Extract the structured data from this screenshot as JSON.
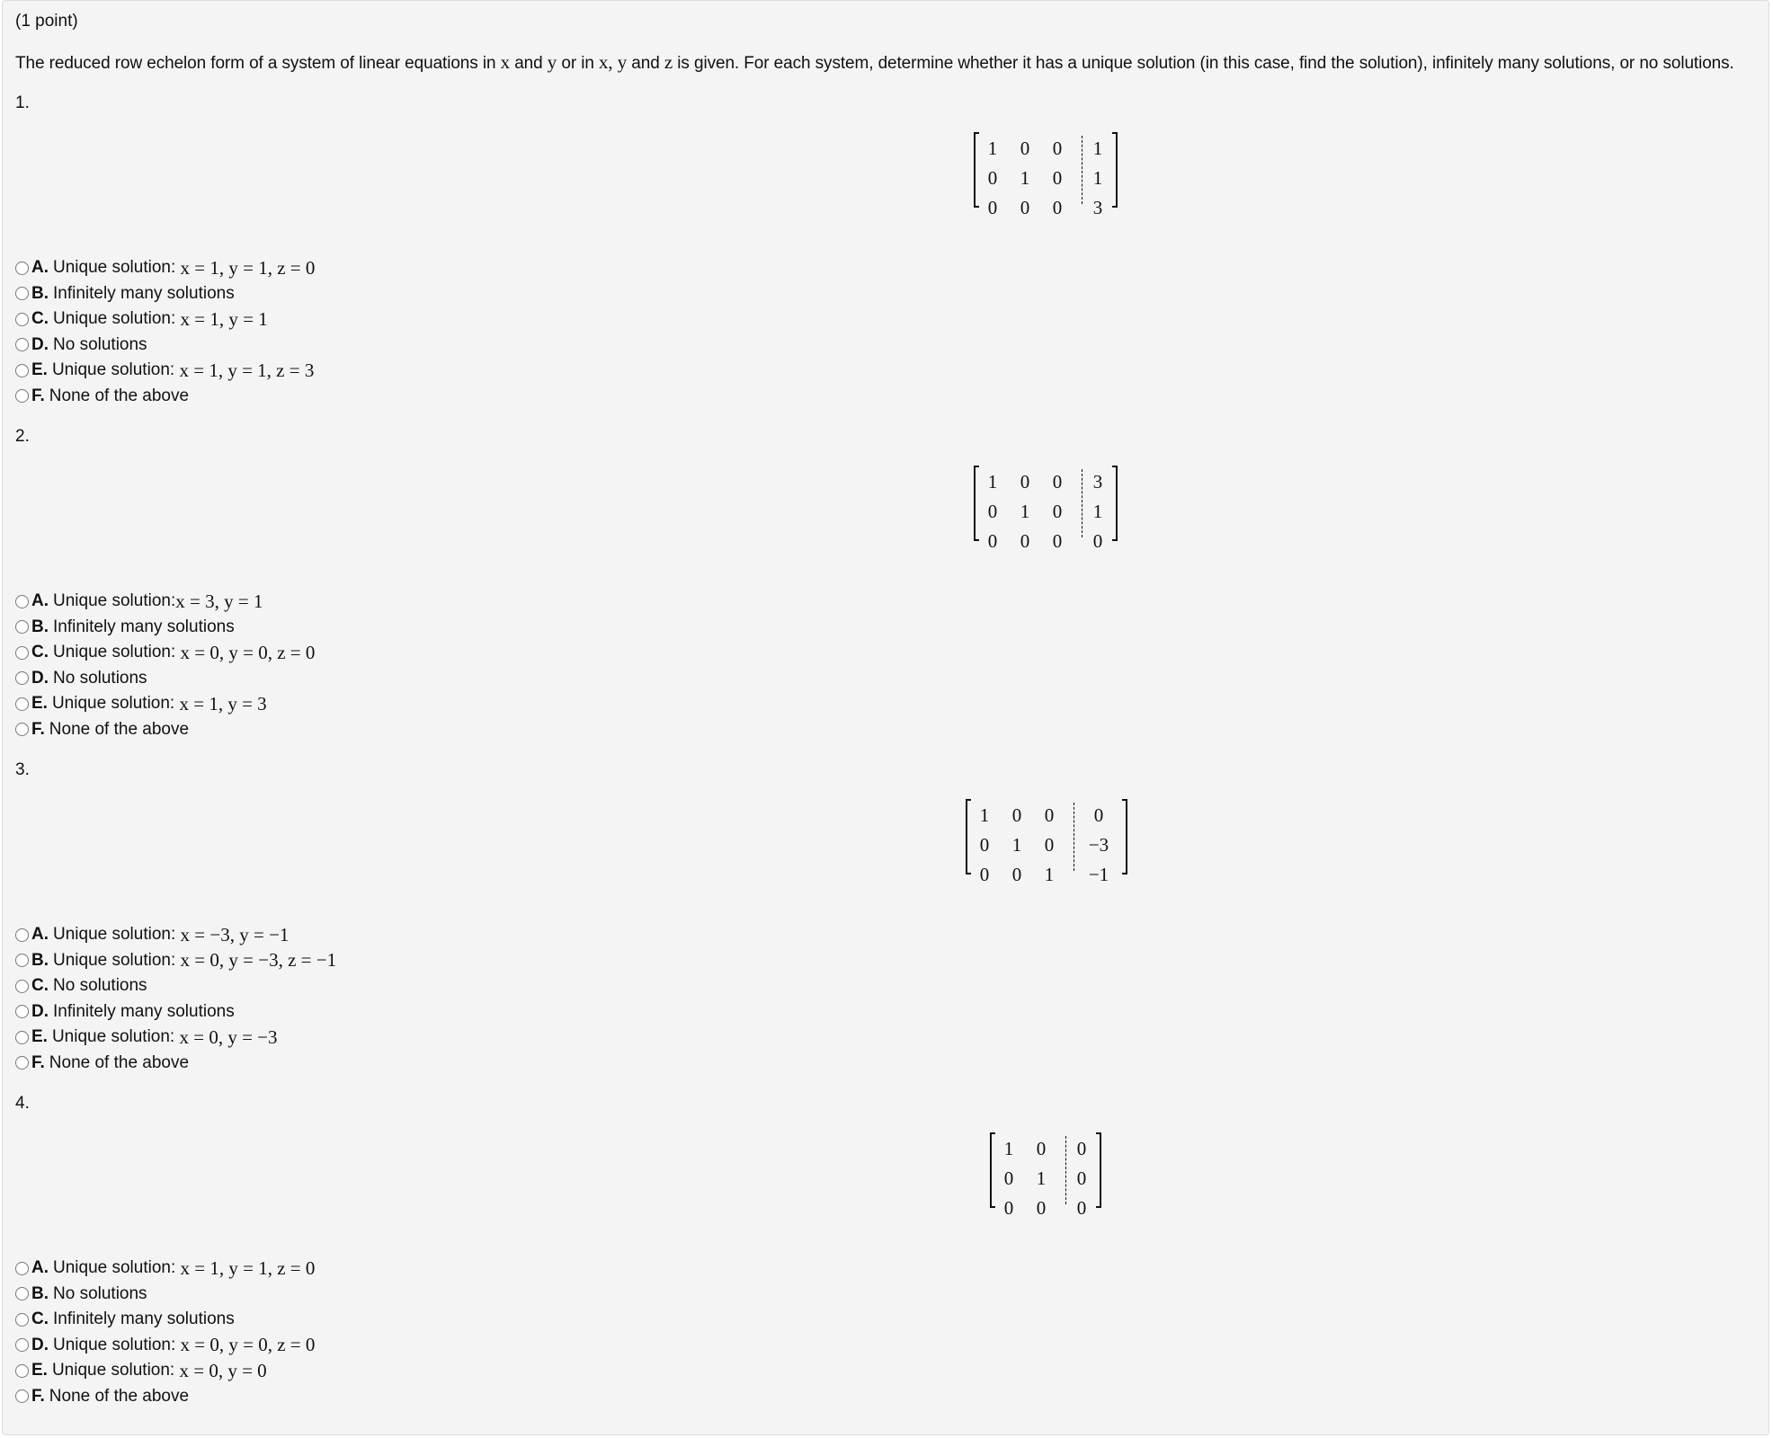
{
  "points": "(1 point)",
  "intro": {
    "p1": "The reduced row echelon form of a system of linear equations in ",
    "x": "x",
    "p2": " and ",
    "y": "y",
    "p3": " or in ",
    "xy": "x, y",
    "p4": " and ",
    "z": "z",
    "p5": " is given. For each system, determine whether it has a unique solution (in this case, find the solution), infinitely many solutions, or no solutions."
  },
  "questions": [
    {
      "number": "1.",
      "matrix": [
        [
          "1",
          "0",
          "0",
          "1"
        ],
        [
          "0",
          "1",
          "0",
          "1"
        ],
        [
          "0",
          "0",
          "0",
          "3"
        ]
      ],
      "options": [
        {
          "letter": "A.",
          "text": "Unique solution: ",
          "math": "x = 1, y = 1, z = 0"
        },
        {
          "letter": "B.",
          "text": "Infinitely many solutions",
          "math": ""
        },
        {
          "letter": "C.",
          "text": "Unique solution: ",
          "math": "x = 1, y = 1"
        },
        {
          "letter": "D.",
          "text": "No solutions",
          "math": ""
        },
        {
          "letter": "E.",
          "text": "Unique solution: ",
          "math": "x = 1, y = 1, z = 3"
        },
        {
          "letter": "F.",
          "text": "None of the above",
          "math": ""
        }
      ]
    },
    {
      "number": "2.",
      "matrix": [
        [
          "1",
          "0",
          "0",
          "3"
        ],
        [
          "0",
          "1",
          "0",
          "1"
        ],
        [
          "0",
          "0",
          "0",
          "0"
        ]
      ],
      "options": [
        {
          "letter": "A.",
          "text": "Unique solution:",
          "math": "x = 3, y = 1"
        },
        {
          "letter": "B.",
          "text": "Infinitely many solutions",
          "math": ""
        },
        {
          "letter": "C.",
          "text": "Unique solution: ",
          "math": "x = 0, y = 0, z = 0"
        },
        {
          "letter": "D.",
          "text": "No solutions",
          "math": ""
        },
        {
          "letter": "E.",
          "text": "Unique solution: ",
          "math": "x = 1, y = 3"
        },
        {
          "letter": "F.",
          "text": "None of the above",
          "math": ""
        }
      ]
    },
    {
      "number": "3.",
      "matrix": [
        [
          "1",
          "0",
          "0",
          "0"
        ],
        [
          "0",
          "1",
          "0",
          "−3"
        ],
        [
          "0",
          "0",
          "1",
          "−1"
        ]
      ],
      "options": [
        {
          "letter": "A.",
          "text": "Unique solution: ",
          "math": "x = −3, y = −1"
        },
        {
          "letter": "B.",
          "text": "Unique solution: ",
          "math": "x = 0, y = −3, z = −1"
        },
        {
          "letter": "C.",
          "text": "No solutions",
          "math": ""
        },
        {
          "letter": "D.",
          "text": "Infinitely many solutions",
          "math": ""
        },
        {
          "letter": "E.",
          "text": "Unique solution: ",
          "math": "x = 0, y = −3"
        },
        {
          "letter": "F.",
          "text": "None of the above",
          "math": ""
        }
      ]
    },
    {
      "number": "4.",
      "matrix": [
        [
          "1",
          "0",
          "0"
        ],
        [
          "0",
          "1",
          "0"
        ],
        [
          "0",
          "0",
          "0"
        ]
      ],
      "options": [
        {
          "letter": "A.",
          "text": "Unique solution: ",
          "math": "x = 1, y = 1, z = 0"
        },
        {
          "letter": "B.",
          "text": "No solutions",
          "math": ""
        },
        {
          "letter": "C.",
          "text": "Infinitely many solutions",
          "math": ""
        },
        {
          "letter": "D.",
          "text": "Unique solution: ",
          "math": "x = 0, y = 0, z = 0"
        },
        {
          "letter": "E.",
          "text": "Unique solution: ",
          "math": "x = 0, y = 0"
        },
        {
          "letter": "F.",
          "text": "None of the above",
          "math": ""
        }
      ]
    }
  ]
}
